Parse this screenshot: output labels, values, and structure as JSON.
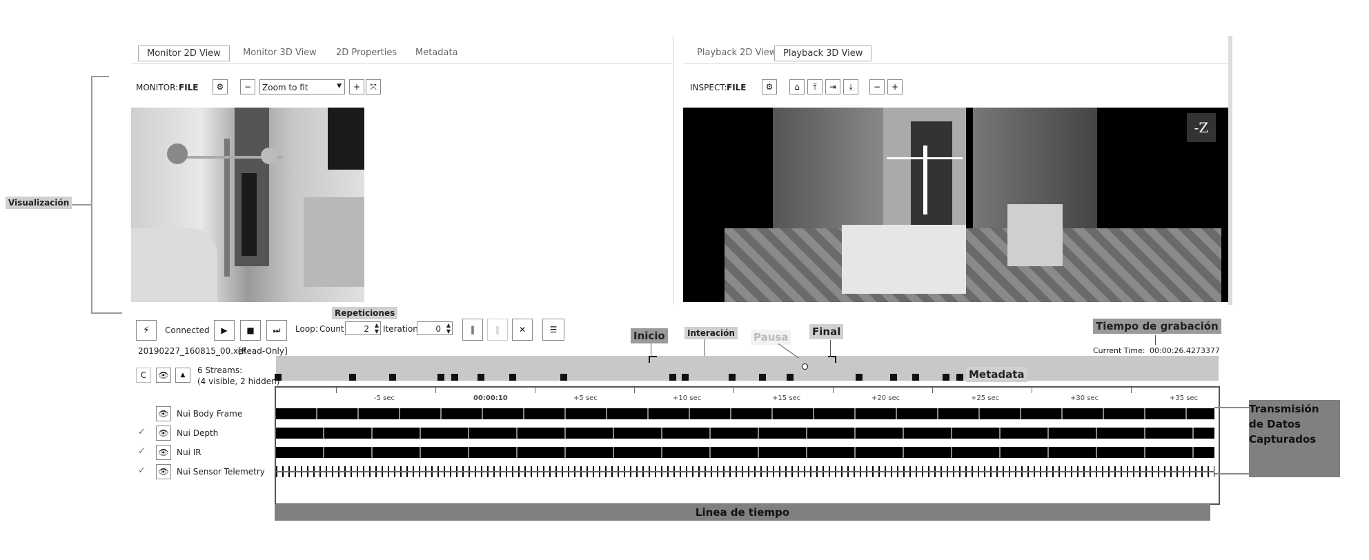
{
  "monitor": {
    "tabs": [
      "Monitor 2D View",
      "Monitor 3D View",
      "2D Properties",
      "Metadata"
    ],
    "label": "MONITOR:",
    "source": "FILE",
    "zoom": "Zoom to fit"
  },
  "playback": {
    "tabs": [
      "Playback 2D View",
      "Playback 3D View"
    ],
    "label": "INSPECT:",
    "source": "FILE",
    "axis_label": "-Z"
  },
  "controls": {
    "connected": "Connected",
    "loop_label": "Loop:",
    "count_label": "Count",
    "count_value": "2",
    "iteration_label": "Iteration",
    "iteration_value": "0",
    "file_name": "20190227_160815_00.xef",
    "file_mode": "[Read-Only]",
    "current_time_label": "Current Time:",
    "current_time_value": "00:00:26.4273377"
  },
  "streams": {
    "summary_line1": "6 Streams:",
    "summary_line2": "(4 visible, 2 hidden)",
    "c_label": "C",
    "items": [
      {
        "name": "Nui Body Frame",
        "checked": false
      },
      {
        "name": "Nui Depth",
        "checked": true
      },
      {
        "name": "Nui IR",
        "checked": true
      },
      {
        "name": "Nui Sensor Telemetry",
        "checked": true
      }
    ]
  },
  "timeline": {
    "ticks": [
      "-5 sec",
      "00:00:10",
      "+5 sec",
      "+10 sec",
      "+15 sec",
      "+20 sec",
      "+25 sec",
      "+30 sec",
      "+35 sec"
    ]
  },
  "annotations": {
    "visualizacion": "Visualización",
    "repeticiones": "Repeticiones",
    "inicio": "Inicio",
    "interaccion": "Interación",
    "pausa": "Pausa",
    "final": "Final",
    "tiempo": "Tiempo de grabación",
    "metadata": "Metadata",
    "transmision": "Transmisión de Datos Capturados",
    "linea": "Linea de tiempo"
  },
  "icons": {
    "gear": "gear-icon",
    "minus": "minus-icon",
    "plus": "plus-icon",
    "fit": "fit-icon",
    "home": "home-icon",
    "play": "play-icon",
    "stop": "stop-icon",
    "step": "step-icon",
    "eye": "eye-icon",
    "list": "list-icon"
  }
}
